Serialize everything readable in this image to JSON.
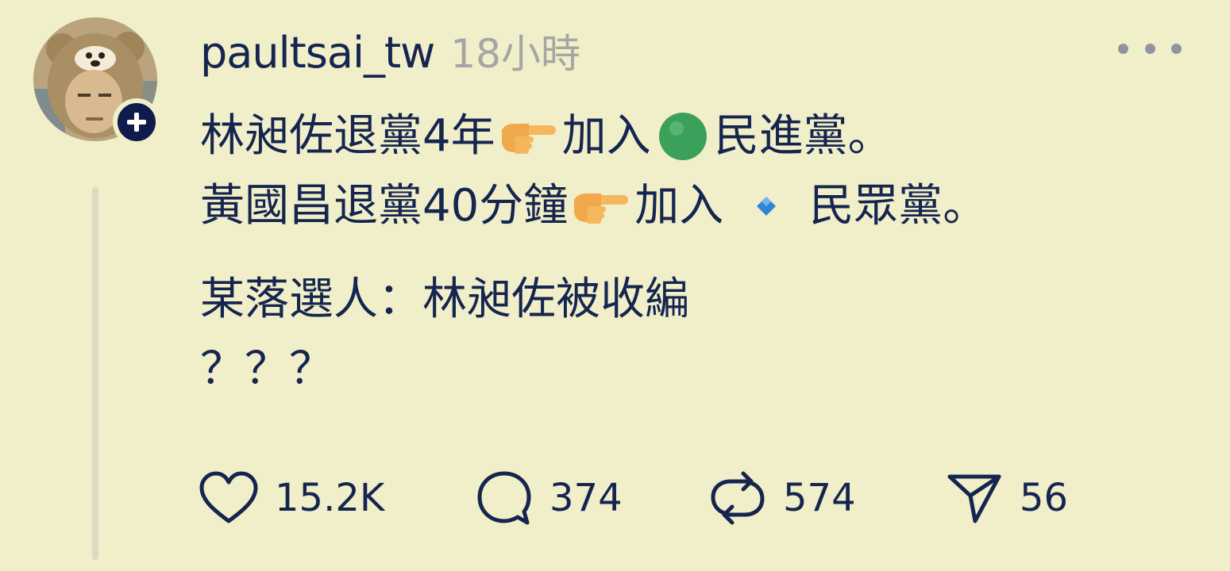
{
  "post": {
    "username": "paultsai_tw",
    "timestamp": "18小時",
    "lines": {
      "l1_a": "林昶佐退黨4年",
      "l1_b": "加入",
      "l1_c": "民進黨。",
      "l2_a": "黃國昌退黨40分鐘",
      "l2_b": "加入",
      "l2_c": "民眾黨。",
      "l3": "某落選人：林昶佐被收編",
      "l4": "？？？"
    },
    "emojis": [
      "pointing-right-emoji",
      "green-circle-emoji",
      "blue-diamond-emoji"
    ]
  },
  "actions": {
    "likes": "15.2K",
    "comments": "374",
    "reposts": "574",
    "shares": "56"
  },
  "colors": {
    "background": "#f1efc9",
    "text": "#15254f",
    "muted": "#a4a6a4",
    "badge": "#0f1b4d",
    "green": "#3aa05a",
    "diamond": "#2f86d6",
    "hand": "#f5b75c"
  }
}
